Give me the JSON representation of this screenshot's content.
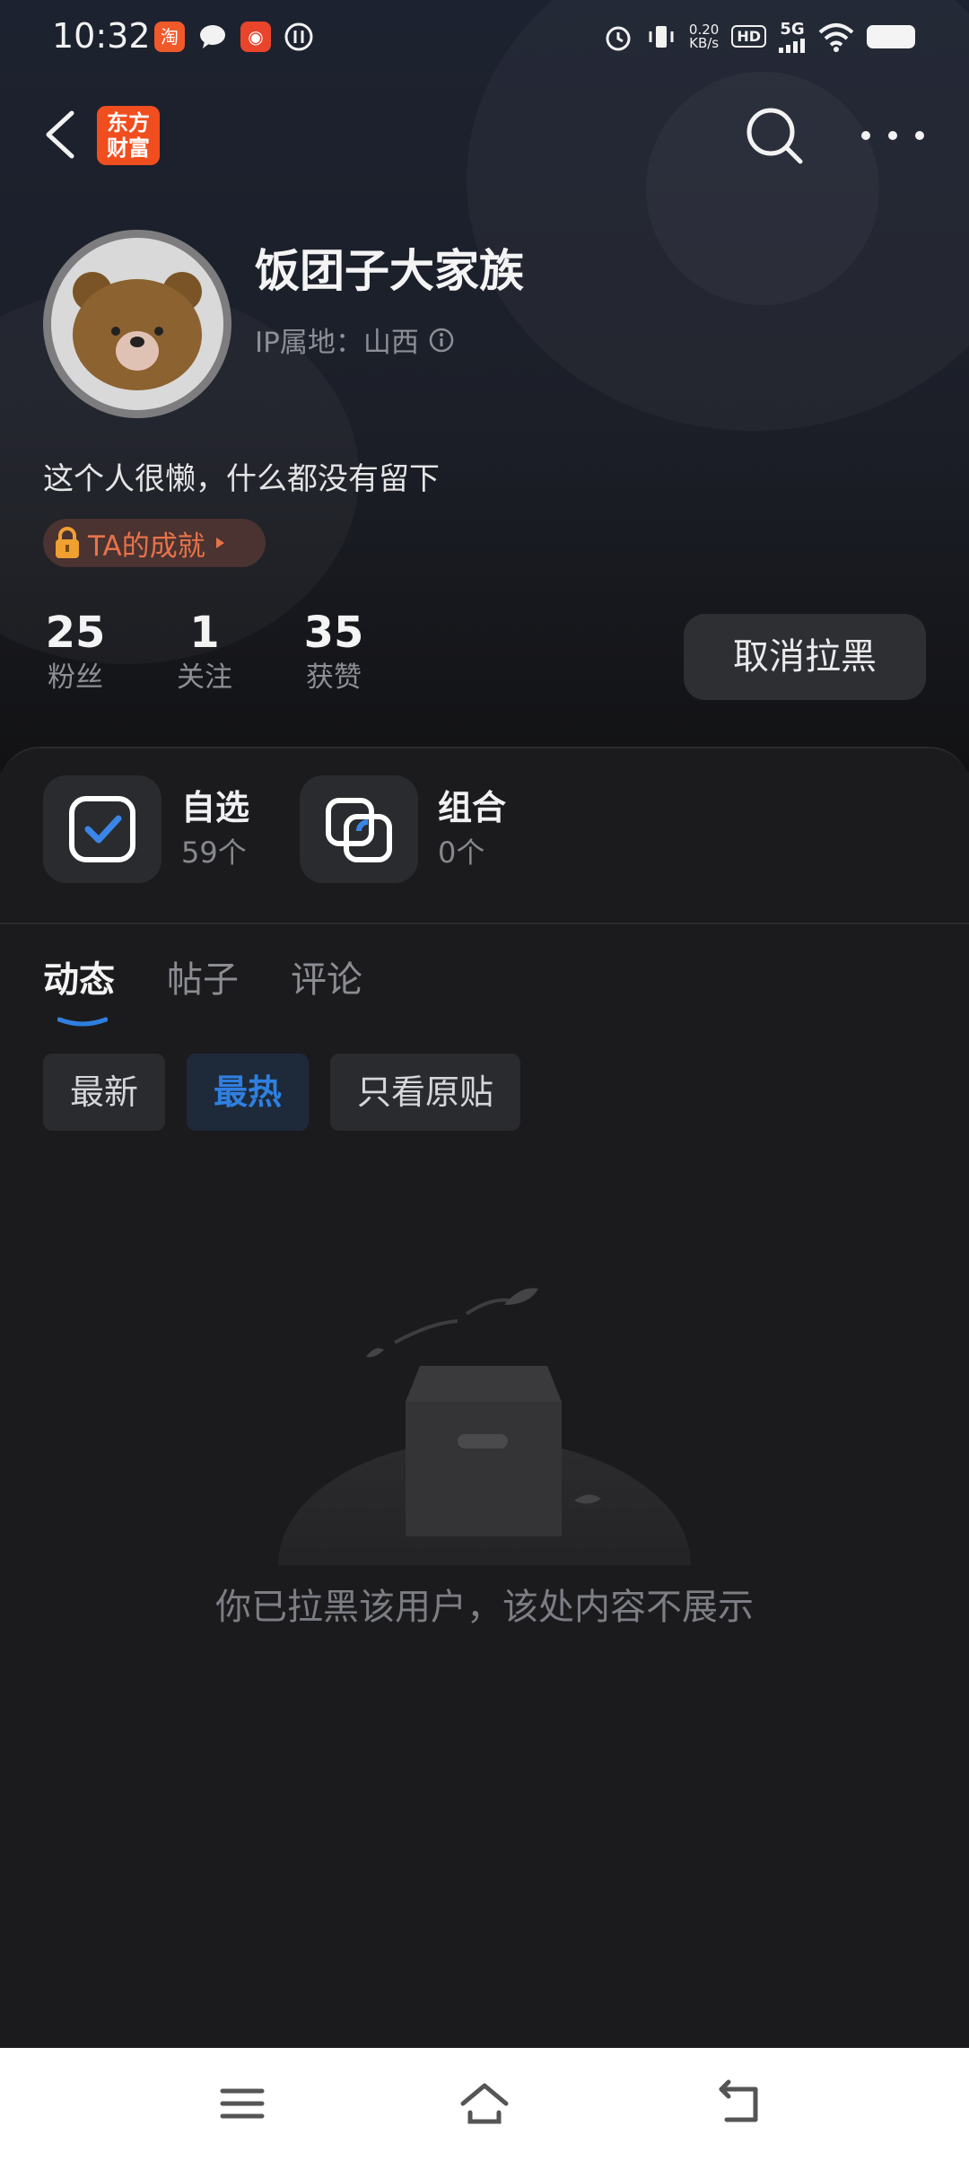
{
  "status_bar": {
    "time": "10:32",
    "net_speed_value": "0.20",
    "net_speed_unit": "KB/s",
    "hd_label": "HD",
    "network_label": "5G"
  },
  "app": {
    "logo_line1": "东方",
    "logo_line2": "财富",
    "brand_color": "#f04e1f"
  },
  "profile": {
    "username": "饭团子大家族",
    "ip_location": "IP属地：山西",
    "bio": "这个人很懒，什么都没有留下",
    "achievement_label": "TA的成就",
    "stats": [
      {
        "value": "25",
        "label": "粉丝"
      },
      {
        "value": "1",
        "label": "关注"
      },
      {
        "value": "35",
        "label": "获赞"
      }
    ],
    "unblock_label": "取消拉黑"
  },
  "quick_links": [
    {
      "title": "自选",
      "count": "59个"
    },
    {
      "title": "组合",
      "count": "0个"
    }
  ],
  "tabs": [
    {
      "label": "动态",
      "active": true
    },
    {
      "label": "帖子",
      "active": false
    },
    {
      "label": "评论",
      "active": false
    }
  ],
  "filters": [
    {
      "label": "最新",
      "active": false
    },
    {
      "label": "最热",
      "active": true
    },
    {
      "label": "只看原贴",
      "active": false
    }
  ],
  "empty_state": {
    "message": "你已拉黑该用户，该处内容不展示"
  },
  "colors": {
    "accent": "#2f7fe0",
    "achievement": "#e8734a"
  }
}
